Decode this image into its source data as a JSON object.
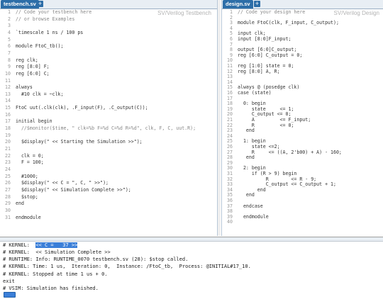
{
  "tabs": {
    "left": {
      "label": "testbench.sv",
      "add": "+",
      "language": "SV/Verilog Testbench"
    },
    "right": {
      "label": "design.sv",
      "add": "+",
      "language": "SV/Verilog Design"
    }
  },
  "testbench": {
    "lines": [
      {
        "n": "1",
        "text": "// Code your testbench here",
        "type": "comment"
      },
      {
        "n": "2",
        "text": "// or browse Examples",
        "type": "comment"
      },
      {
        "n": "3",
        "text": "",
        "type": "code"
      },
      {
        "n": "4",
        "text": "`timescale 1 ns / 100 ps",
        "type": "code"
      },
      {
        "n": "5",
        "text": "",
        "type": "code"
      },
      {
        "n": "6",
        "text": "module FtoC_tb();",
        "type": "code"
      },
      {
        "n": "7",
        "text": "",
        "type": "code"
      },
      {
        "n": "8",
        "text": "reg clk;",
        "type": "code"
      },
      {
        "n": "9",
        "text": "reg [8:0] F;",
        "type": "code"
      },
      {
        "n": "10",
        "text": "reg [6:0] C;",
        "type": "code"
      },
      {
        "n": "11",
        "text": "",
        "type": "code"
      },
      {
        "n": "12",
        "text": "always",
        "type": "code"
      },
      {
        "n": "13",
        "text": "  #10 clk = ~clk;",
        "type": "code"
      },
      {
        "n": "14",
        "text": "",
        "type": "code"
      },
      {
        "n": "15",
        "text": "FtoC uut(.clk(clk), .F_input(F), .C_output(C));",
        "type": "code"
      },
      {
        "n": "16",
        "text": "",
        "type": "code"
      },
      {
        "n": "17",
        "text": "initial begin",
        "type": "code"
      },
      {
        "n": "18",
        "text": "  //$monitor($time, \" clk=%b F=%d C=%d R=%d\", clk, F, C, uut.R);",
        "type": "comment"
      },
      {
        "n": "19",
        "text": "",
        "type": "code"
      },
      {
        "n": "20",
        "text": "  $display(\" << Starting the Simulation >>\");",
        "type": "code"
      },
      {
        "n": "21",
        "text": "",
        "type": "code"
      },
      {
        "n": "22",
        "text": "  clk = 0;",
        "type": "code"
      },
      {
        "n": "23",
        "text": "  F = 100;",
        "type": "code"
      },
      {
        "n": "24",
        "text": "",
        "type": "code"
      },
      {
        "n": "25",
        "text": "  #1000;",
        "type": "code"
      },
      {
        "n": "26",
        "text": "  $display(\" << C = \", C, \" >>\");",
        "type": "code"
      },
      {
        "n": "27",
        "text": "  $display(\" << Simulation Complete >>\");",
        "type": "code"
      },
      {
        "n": "28",
        "text": "  $stop;",
        "type": "code"
      },
      {
        "n": "29",
        "text": "end",
        "type": "code"
      },
      {
        "n": "30",
        "text": "",
        "type": "code"
      },
      {
        "n": "31",
        "text": "endmodule",
        "type": "code"
      }
    ]
  },
  "design": {
    "lines": [
      {
        "n": "1",
        "text": "// Code your design here",
        "type": "comment"
      },
      {
        "n": "2",
        "text": "",
        "type": "code"
      },
      {
        "n": "3",
        "text": "module FtoC(clk, F_input, C_output);",
        "type": "code"
      },
      {
        "n": "4",
        "text": "",
        "type": "code"
      },
      {
        "n": "5",
        "text": "input clk;",
        "type": "code"
      },
      {
        "n": "6",
        "text": "input [8:0]F_input;",
        "type": "code"
      },
      {
        "n": "7",
        "text": "",
        "type": "code"
      },
      {
        "n": "8",
        "text": "output [6:0]C_output;",
        "type": "code"
      },
      {
        "n": "9",
        "text": "reg [6:0] C_output = 0;",
        "type": "code"
      },
      {
        "n": "10",
        "text": "",
        "type": "code"
      },
      {
        "n": "11",
        "text": "reg [1:0] state = 0;",
        "type": "code"
      },
      {
        "n": "12",
        "text": "reg [8:0] A, R;",
        "type": "code"
      },
      {
        "n": "13",
        "text": "",
        "type": "code"
      },
      {
        "n": "14",
        "text": "",
        "type": "code"
      },
      {
        "n": "15",
        "text": "always @ (posedge clk)",
        "type": "code"
      },
      {
        "n": "16",
        "text": "case (state)",
        "type": "code"
      },
      {
        "n": "17",
        "text": "",
        "type": "code"
      },
      {
        "n": "18",
        "text": "  0: begin",
        "type": "code"
      },
      {
        "n": "19",
        "text": "     state     <= 1;",
        "type": "code"
      },
      {
        "n": "20",
        "text": "     C_output <= 0;",
        "type": "code"
      },
      {
        "n": "21",
        "text": "     A         <= F_input;",
        "type": "code"
      },
      {
        "n": "22",
        "text": "     R         <= 0;",
        "type": "code"
      },
      {
        "n": "23",
        "text": "   end",
        "type": "code"
      },
      {
        "n": "24",
        "text": "",
        "type": "code"
      },
      {
        "n": "25",
        "text": "  1: begin",
        "type": "code"
      },
      {
        "n": "26",
        "text": "     state <=2;",
        "type": "code"
      },
      {
        "n": "27",
        "text": "     R     <= ((A, 2'b00) + A) - 160;",
        "type": "code"
      },
      {
        "n": "28",
        "text": "   end",
        "type": "code"
      },
      {
        "n": "29",
        "text": "",
        "type": "code"
      },
      {
        "n": "30",
        "text": "  2: begin",
        "type": "code"
      },
      {
        "n": "31",
        "text": "     if (R > 9) begin",
        "type": "code"
      },
      {
        "n": "32",
        "text": "          R        <= R - 9;",
        "type": "code"
      },
      {
        "n": "33",
        "text": "          C_output <= C_output + 1;",
        "type": "code"
      },
      {
        "n": "34",
        "text": "       end",
        "type": "code"
      },
      {
        "n": "35",
        "text": "   end",
        "type": "code"
      },
      {
        "n": "36",
        "text": "",
        "type": "code"
      },
      {
        "n": "37",
        "text": "  endcase",
        "type": "code"
      },
      {
        "n": "38",
        "text": "",
        "type": "code"
      },
      {
        "n": "39",
        "text": "  endmodule",
        "type": "code"
      },
      {
        "n": "40",
        "text": "",
        "type": "code"
      }
    ]
  },
  "console": {
    "kernel_prefix": "# KERNEL:  ",
    "kernel_highlight": "<< C =   37 >>",
    "lines": [
      "# KERNEL:  << Simulation Complete >>",
      "# RUNTIME: Info: RUNTIME_0070 testbench.sv (28): $stop called.",
      "# KERNEL: Time: 1 us,  Iteration: 0,  Instance: /FtoC_tb,  Process: @INITIAL#17_10.",
      "# KERNEL: Stopped at time 1 us + 0.",
      "exit",
      "# VSIM: Simulation has finished."
    ]
  },
  "colors": {
    "accent": "#2d6ea8",
    "highlight": "#3b7fd8",
    "comment": "#888888",
    "line_numbers": "#999999"
  }
}
